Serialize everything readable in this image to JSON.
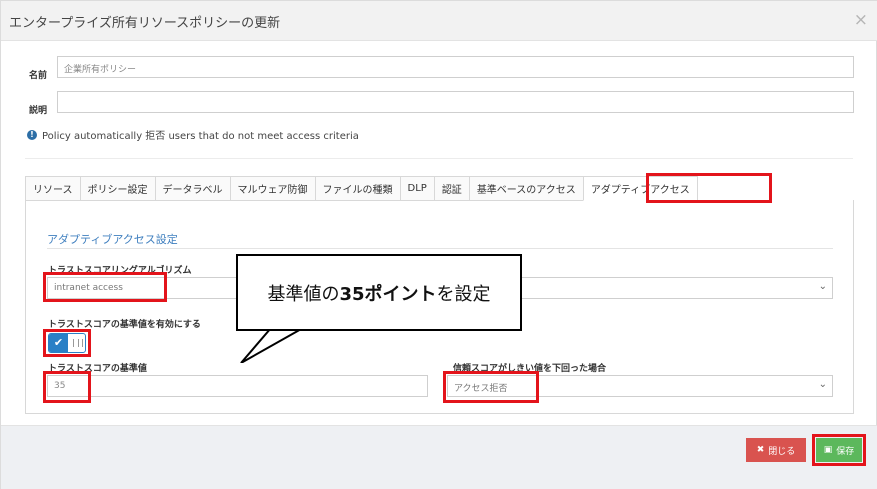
{
  "dialog": {
    "title": "エンタープライズ所有リソースポリシーの更新",
    "close_glyph": "×"
  },
  "form": {
    "name_label": "名前",
    "name_value": "企業所有ポリシー",
    "description_label": "説明",
    "description_value": "",
    "info_icon": "info-icon",
    "info_text": "Policy automatically 拒否 users that do not meet access criteria"
  },
  "tabs": [
    {
      "label": "リソース"
    },
    {
      "label": "ポリシー設定"
    },
    {
      "label": "データラベル"
    },
    {
      "label": "マルウェア防御"
    },
    {
      "label": "ファイルの種類"
    },
    {
      "label": "DLP"
    },
    {
      "label": "認証"
    },
    {
      "label": "基準ベースのアクセス"
    },
    {
      "label": "アダプティブアクセス"
    }
  ],
  "adaptive": {
    "section_title": "アダプティブアクセス設定",
    "algorithm_label": "トラストスコアリングアルゴリズム",
    "algorithm_value": "intranet access",
    "baseline_enable_label": "トラストスコアの基準値を有効にする",
    "baseline_toggle_on": true,
    "baseline_label": "トラストスコアの基準値",
    "baseline_value": "35",
    "below_label": "信頼スコアがしきい値を下回った場合",
    "below_value": "アクセス拒否"
  },
  "callout": {
    "pre": "基準値の",
    "bold": "35ポイント",
    "post": "を設定"
  },
  "footer": {
    "close_label": "閉じる",
    "save_label": "保存"
  },
  "colors": {
    "accent": "#2a80c6",
    "highlight": "#e3141b",
    "close_button": "#d9534f",
    "save_button": "#5cb85c"
  }
}
